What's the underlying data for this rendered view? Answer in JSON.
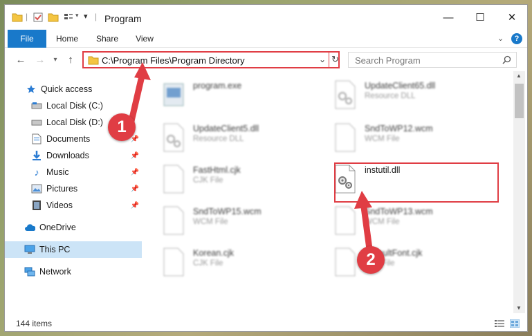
{
  "window": {
    "title": "Program",
    "minimize": "—",
    "maximize": "☐",
    "close": "✕"
  },
  "ribbon": {
    "tabs": [
      "File",
      "Home",
      "Share",
      "View"
    ]
  },
  "address": {
    "path": "C:\\Program Files\\Program Directory"
  },
  "search": {
    "placeholder": "Search Program"
  },
  "sidebar": {
    "items": [
      {
        "label": "Quick access",
        "icon": "star-icon",
        "pinned": false
      },
      {
        "label": "Local Disk (C:)",
        "icon": "drive-icon",
        "pinned": true
      },
      {
        "label": "Local Disk (D:)",
        "icon": "drive-icon",
        "pinned": true
      },
      {
        "label": "Documents",
        "icon": "documents-icon",
        "pinned": true
      },
      {
        "label": "Downloads",
        "icon": "downloads-icon",
        "pinned": true
      },
      {
        "label": "Music",
        "icon": "music-icon",
        "pinned": true
      },
      {
        "label": "Pictures",
        "icon": "pictures-icon",
        "pinned": true
      },
      {
        "label": "Videos",
        "icon": "videos-icon",
        "pinned": true
      },
      {
        "label": "OneDrive",
        "icon": "onedrive-icon",
        "pinned": false
      },
      {
        "label": "This PC",
        "icon": "this-pc-icon",
        "pinned": false
      },
      {
        "label": "Network",
        "icon": "network-icon",
        "pinned": false
      }
    ]
  },
  "files": [
    {
      "name": "program.exe",
      "type": ""
    },
    {
      "name": "UpdateClient65.dll",
      "type": "Resource DLL"
    },
    {
      "name": "UpdateClient5.dll",
      "type": "Resource DLL"
    },
    {
      "name": "SndToWP12.wcm",
      "type": "WCM File"
    },
    {
      "name": "FastHtml.cjk",
      "type": "CJK File"
    },
    {
      "name": "instutil.dll",
      "type": ""
    },
    {
      "name": "SndToWP15.wcm",
      "type": "WCM File"
    },
    {
      "name": "SndToWP13.wcm",
      "type": "WCM File"
    },
    {
      "name": "Korean.cjk",
      "type": "CJK File"
    },
    {
      "name": "DefaultFont.cjk",
      "type": "CJK File"
    }
  ],
  "status": {
    "item_count": "144 items"
  },
  "annotations": {
    "callout1": "1",
    "callout2": "2"
  },
  "colors": {
    "accent": "#1979ca",
    "highlight": "#e03d44",
    "selected": "#cce4f7"
  }
}
